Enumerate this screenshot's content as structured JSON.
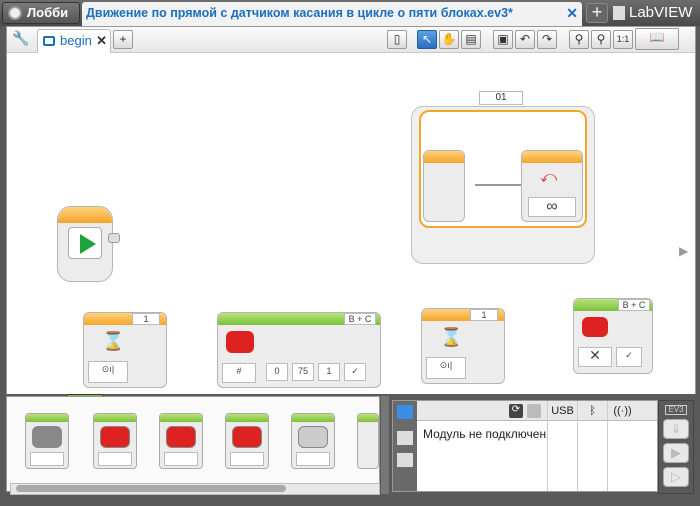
{
  "titlebar": {
    "lobby_label": "Лобби",
    "project_title": "Движение по прямой с датчиком касания в цикле о пяти блоках.ev3*",
    "close_glyph": "✕",
    "add_glyph": "+",
    "logo": "LabVIEW"
  },
  "program": {
    "tab_label": "begin",
    "tab_close": "✕",
    "add_tab": "+",
    "zoom_reset": "1:1"
  },
  "loop": {
    "counter": "01",
    "mode_glyph": "∞"
  },
  "blocks": [
    {
      "port": "1"
    },
    {
      "port": "B + C",
      "values": [
        "0",
        "75",
        "1"
      ]
    },
    {
      "port": "1"
    },
    {
      "port": "B + C"
    }
  ],
  "palette": {
    "tab_colors": [
      "#7cc13b",
      "#f4a52c",
      "#f1d400",
      "#d6261f",
      "#1565c0",
      "#17a8a0"
    ]
  },
  "hardware": {
    "status": "Модуль не подключен",
    "usb": "USB",
    "bt": "ᛒ",
    "wifi": "((·))",
    "ev3_label": "EV3"
  },
  "colors": {
    "accent": "#1a6fbf",
    "start": "#1fa33a"
  }
}
